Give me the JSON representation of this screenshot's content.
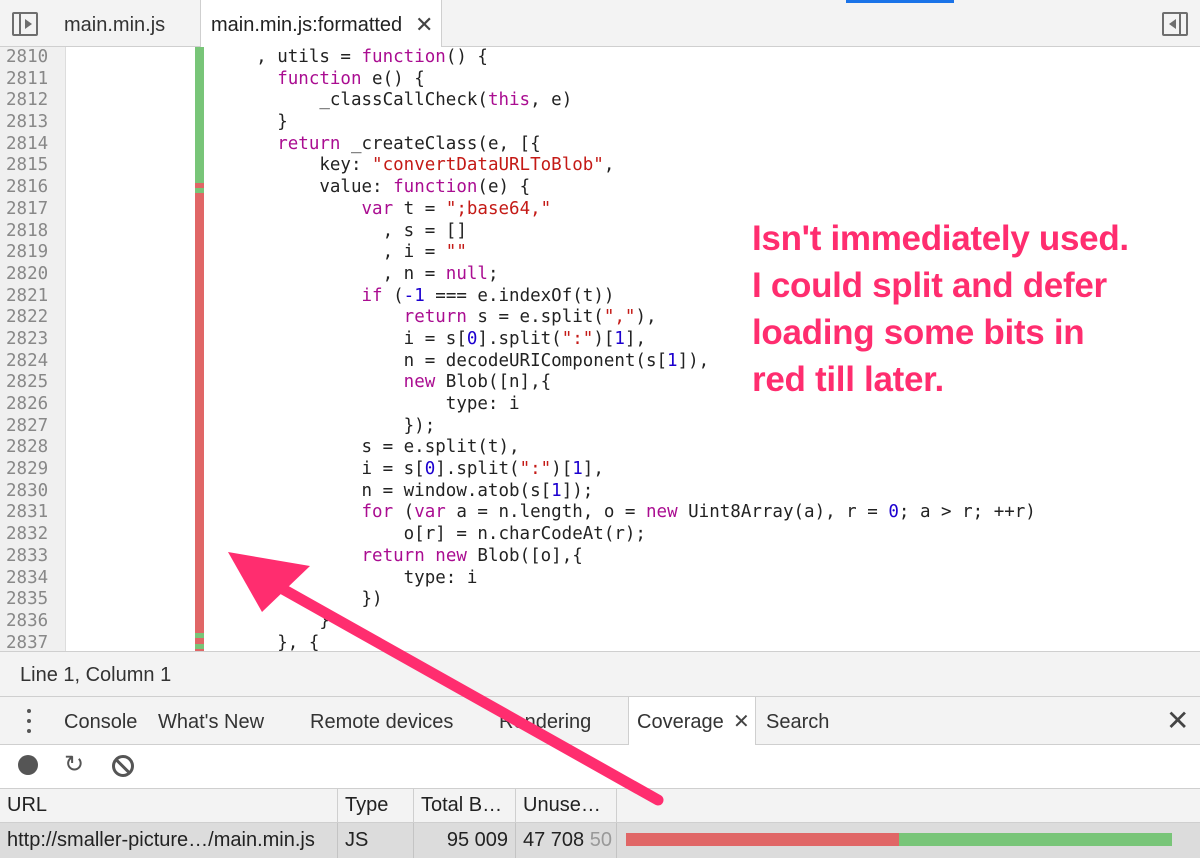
{
  "tabs": {
    "left_tab": "main.min.js",
    "active_tab": "main.min.js:formatted",
    "close_glyph": "✕"
  },
  "editor": {
    "line_numbers": [
      "2810",
      "2811",
      "2812",
      "2813",
      "2814",
      "2815",
      "2816",
      "2817",
      "2818",
      "2819",
      "2820",
      "2821",
      "2822",
      "2823",
      "2824",
      "2825",
      "2826",
      "2827",
      "2828",
      "2829",
      "2830",
      "2831",
      "2832",
      "2833",
      "2834",
      "2835",
      "2836",
      "2837"
    ],
    "coverage_colors": {
      "used": "#78c578",
      "unused": "#e06666"
    },
    "coverage_by_line": [
      "used",
      "used",
      "used",
      "used",
      "used",
      "used",
      "mixed",
      "unused",
      "unused",
      "unused",
      "unused",
      "unused",
      "unused",
      "unused",
      "unused",
      "unused",
      "unused",
      "unused",
      "unused",
      "unused",
      "unused",
      "unused",
      "unused",
      "unused",
      "unused",
      "unused",
      "unused",
      "mixed"
    ],
    "code_lines": [
      [
        [
          "",
          "    , utils = "
        ],
        [
          "kw",
          "function"
        ],
        [
          "",
          "() {"
        ]
      ],
      [
        [
          "",
          "      "
        ],
        [
          "kw",
          "function"
        ],
        [
          "",
          " e() {"
        ]
      ],
      [
        [
          "",
          "          _classCallCheck("
        ],
        [
          "kw",
          "this"
        ],
        [
          "",
          ", e)"
        ]
      ],
      [
        [
          "",
          "      }"
        ]
      ],
      [
        [
          "",
          "      "
        ],
        [
          "kw",
          "return"
        ],
        [
          "",
          " _createClass(e, [{"
        ]
      ],
      [
        [
          "",
          "          key: "
        ],
        [
          "str",
          "\"convertDataURLToBlob\""
        ],
        [
          "",
          ","
        ]
      ],
      [
        [
          "",
          "          value: "
        ],
        [
          "kw",
          "function"
        ],
        [
          "",
          "(e) {"
        ]
      ],
      [
        [
          "",
          "              "
        ],
        [
          "kw",
          "var"
        ],
        [
          "",
          " t = "
        ],
        [
          "str",
          "\";base64,\""
        ]
      ],
      [
        [
          "",
          "                , s = []"
        ]
      ],
      [
        [
          "",
          "                , i = "
        ],
        [
          "str",
          "\"\""
        ]
      ],
      [
        [
          "",
          "                , n = "
        ],
        [
          "kw",
          "null"
        ],
        [
          "",
          ";"
        ]
      ],
      [
        [
          "",
          "              "
        ],
        [
          "kw",
          "if"
        ],
        [
          "",
          " ("
        ],
        [
          "num",
          "-1"
        ],
        [
          "",
          " === e.indexOf(t))"
        ]
      ],
      [
        [
          "",
          "                  "
        ],
        [
          "kw",
          "return"
        ],
        [
          "",
          " s = e.split("
        ],
        [
          "str",
          "\",\""
        ],
        [
          "",
          "),"
        ]
      ],
      [
        [
          "",
          "                  i = s["
        ],
        [
          "num",
          "0"
        ],
        [
          "",
          "].split("
        ],
        [
          "str",
          "\":\""
        ],
        [
          "",
          ")["
        ],
        [
          "num",
          "1"
        ],
        [
          "",
          "],"
        ]
      ],
      [
        [
          "",
          "                  n = decodeURIComponent(s["
        ],
        [
          "num",
          "1"
        ],
        [
          "",
          "]),"
        ]
      ],
      [
        [
          "",
          "                  "
        ],
        [
          "kw",
          "new"
        ],
        [
          "",
          " Blob([n],{"
        ]
      ],
      [
        [
          "",
          "                      type: i"
        ]
      ],
      [
        [
          "",
          "                  });"
        ]
      ],
      [
        [
          "",
          "              s = e.split(t),"
        ]
      ],
      [
        [
          "",
          "              i = s["
        ],
        [
          "num",
          "0"
        ],
        [
          "",
          "].split("
        ],
        [
          "str",
          "\":\""
        ],
        [
          "",
          ")["
        ],
        [
          "num",
          "1"
        ],
        [
          "",
          "],"
        ]
      ],
      [
        [
          "",
          "              n = window.atob(s["
        ],
        [
          "num",
          "1"
        ],
        [
          "",
          "]);"
        ]
      ],
      [
        [
          "",
          "              "
        ],
        [
          "kw",
          "for"
        ],
        [
          "",
          " ("
        ],
        [
          "kw",
          "var"
        ],
        [
          "",
          " a = n.length, o = "
        ],
        [
          "kw",
          "new"
        ],
        [
          "",
          " Uint8Array(a), r = "
        ],
        [
          "num",
          "0"
        ],
        [
          "",
          "; a > r; ++r)"
        ]
      ],
      [
        [
          "",
          "                  o[r] = n.charCodeAt(r);"
        ]
      ],
      [
        [
          "",
          "              "
        ],
        [
          "kw",
          "return"
        ],
        [
          "",
          " "
        ],
        [
          "kw",
          "new"
        ],
        [
          "",
          " Blob([o],{"
        ]
      ],
      [
        [
          "",
          "                  type: i"
        ]
      ],
      [
        [
          "",
          "              })"
        ]
      ],
      [
        [
          "",
          "          }"
        ]
      ],
      [
        [
          "",
          "      }, {"
        ]
      ]
    ]
  },
  "annotation": "Isn't immediately used. I could split and defer loading some bits in red till later.",
  "annotation_color": "#ff2d6f",
  "status_bar": "Line 1, Column 1",
  "drawer": {
    "tabs": [
      "Console",
      "What's New",
      "Remote devices",
      "Rendering",
      "Coverage",
      "Search"
    ],
    "active_tab": "Coverage"
  },
  "coverage": {
    "columns": [
      "URL",
      "Type",
      "Total B…",
      "Unuse…"
    ],
    "rows": [
      {
        "url": "http://smaller-picture…/main.min.js",
        "type": "JS",
        "total": "95 009",
        "unused": "47 708",
        "unused_pct_text": "50",
        "unused_fraction": 0.5
      }
    ]
  }
}
